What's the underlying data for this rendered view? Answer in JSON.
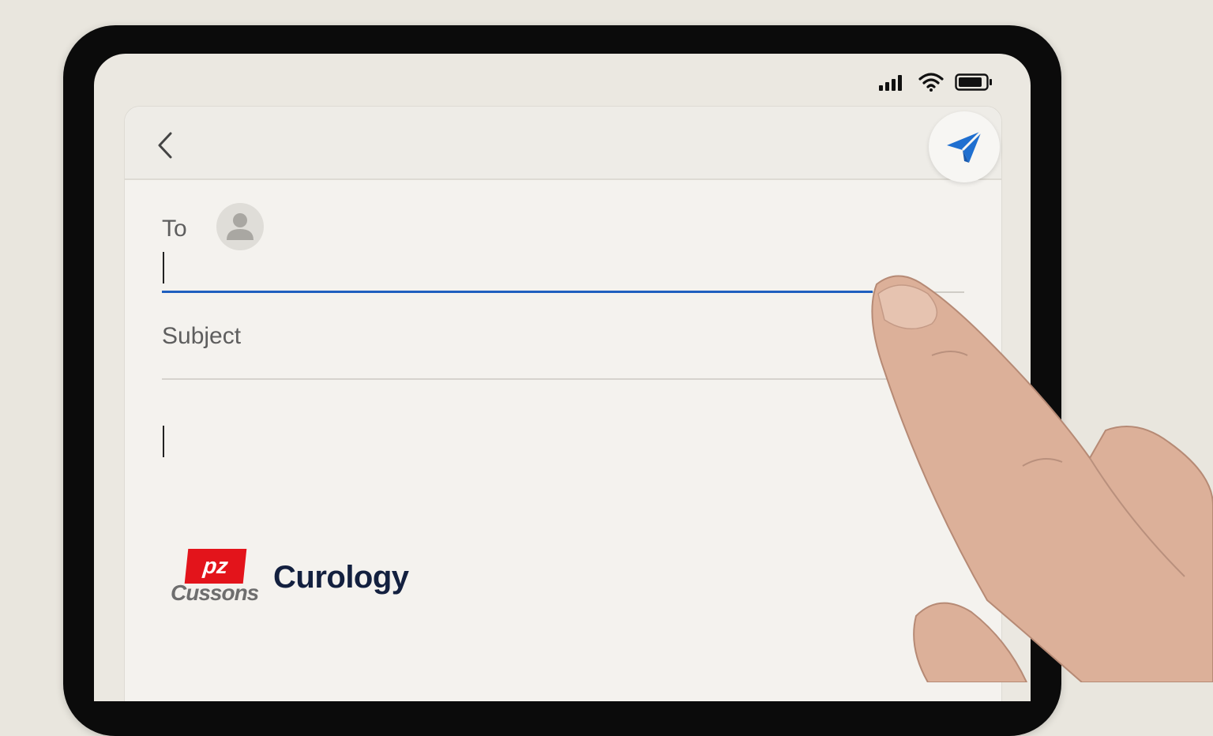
{
  "compose": {
    "to_label": "To",
    "to_value": "",
    "subject_placeholder": "Subject",
    "body_value": ""
  },
  "brands": {
    "pz_mark": "pz",
    "pz_name": "Cussons",
    "curology": "Curology"
  },
  "icons": {
    "back": "chevron-left-icon",
    "send": "send-icon",
    "avatar": "person-icon",
    "signal": "signal-icon",
    "wifi": "wifi-icon",
    "battery": "battery-icon"
  },
  "colors": {
    "accent": "#1f6fd0",
    "focus_underline": "#1f5fbf",
    "pz_red": "#e3141b",
    "curology_navy": "#13203f"
  }
}
